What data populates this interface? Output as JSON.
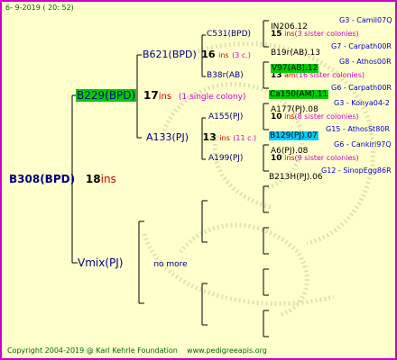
{
  "header": {
    "date": "6-  9-2019 ( 20:  52)"
  },
  "footer": {
    "copyright": "Copyright 2004-2019 @ Karl Kehrle Foundation",
    "url": "www.pedigreeapis.org"
  },
  "root": {
    "label": "B308(BPD)",
    "num": "18",
    "ins": "ins"
  },
  "gen1": {
    "top": {
      "label": "B229(BPD)",
      "num": "17",
      "ins": "ins",
      "note": "(1 single colony)"
    },
    "bottom": {
      "label": "Vmix(PJ)",
      "note": "no more"
    }
  },
  "gen2": {
    "b621": {
      "label": "B621(BPD)",
      "num": "16",
      "ins": "ins",
      "note": "(3 c.)"
    },
    "a133": {
      "label": "A133(PJ)",
      "num": "13",
      "ins": "ins",
      "note": "(11 c.)"
    }
  },
  "gen3": {
    "c531": {
      "label": "C531(BPD)",
      "num": "15",
      "ins": "ins",
      "note": "(3 sister colonies)"
    },
    "b38r": {
      "label": "B38r(AB)",
      "num": "13",
      "ins": "am",
      "note": "(16 sister colonies)"
    },
    "a155": {
      "label": "A155(PJ)",
      "num": "10",
      "ins": "ins",
      "note": "(8 sister colonies)"
    },
    "a199": {
      "label": "A199(PJ)",
      "num": "10",
      "ins": "ins",
      "note": "(9 sister colonies)"
    }
  },
  "gen4": [
    {
      "name": "IN206.12",
      "gen": "G3",
      "place": "Camil07Q"
    },
    {
      "name": "B19r(AB).13",
      "gen": "G7",
      "place": "Carpath00R"
    },
    {
      "name": "V97(AB).12",
      "gen": "G8",
      "place": "Athos00R"
    },
    {
      "name": "Ca150(AM).11",
      "gen": "G6",
      "place": "Carpath00R"
    },
    {
      "name": "A177(PJ).08",
      "gen": "G3",
      "place": "Konya04-2"
    },
    {
      "name": "B129(PJ).07",
      "gen": "G15",
      "place": "AthosSt80R"
    },
    {
      "name": "A6(PJ).08",
      "gen": "G6",
      "place": "Cankiri97Q"
    },
    {
      "name": "B213H(PJ).06",
      "gen": "G12",
      "place": "SinopEgg86R"
    }
  ],
  "colors": {
    "background": "#ffffcc",
    "border": "#cc00cc",
    "highlight_green": "#00cc00",
    "highlight_cyan": "#00ccff",
    "ins_red": "#cc0000"
  }
}
